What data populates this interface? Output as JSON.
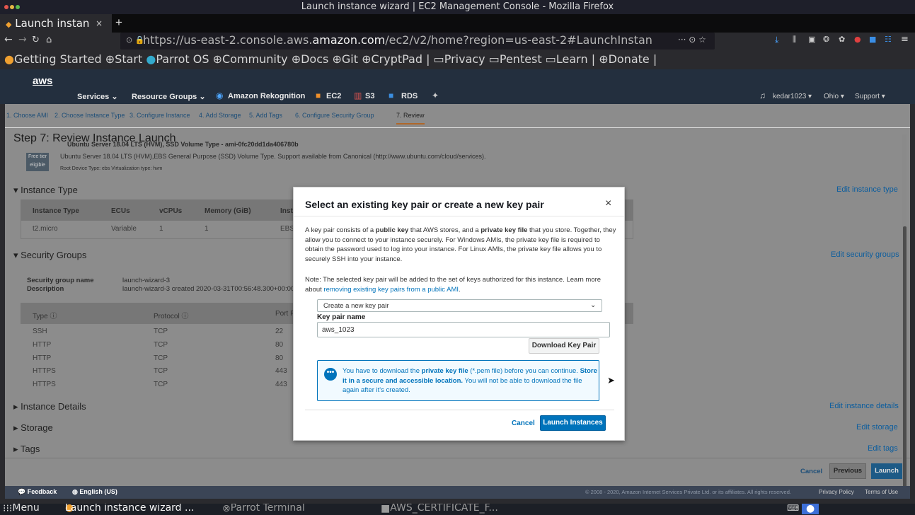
{
  "window": {
    "title": "Launch instance wizard | EC2 Management Console - Mozilla Firefox"
  },
  "browser": {
    "tab_label": "Launch instan",
    "tab_close": "×",
    "new_tab": "+",
    "url_prefix": "https://us-east-2.console.aws.",
    "url_domain": "amazon.com",
    "url_suffix": "/ec2/v2/home?region=us-east-2#LaunchInstan",
    "url_more": "··· ⊙ ☆",
    "bookmarks": [
      "Getting Started",
      "Start",
      "Parrot OS",
      "Community",
      "Docs",
      "Git",
      "CryptPad",
      "Privacy",
      "Pentest",
      "Learn",
      "Donate"
    ]
  },
  "aws_nav": {
    "logo": "aws",
    "services": "Services",
    "resource_groups": "Resource Groups",
    "rekognition": "Amazon Rekognition",
    "ec2": "EC2",
    "s3": "S3",
    "rds": "RDS",
    "user": "kedar1023",
    "region": "Ohio",
    "support": "Support"
  },
  "steps": [
    "1. Choose AMI",
    "2. Choose Instance Type",
    "3. Configure Instance",
    "4. Add Storage",
    "5. Add Tags",
    "6. Configure Security Group",
    "7. Review"
  ],
  "page": {
    "step_title": "Step 7: Review Instance Launch",
    "ami_title": "Ubuntu Server 18.04 LTS (HVM), SSD Volume Type - ami-0fc20dd1da406780b",
    "free_tier_1": "Free tier",
    "free_tier_2": "eligible",
    "ami_desc": "Ubuntu Server 18.04 LTS (HVM),EBS General Purpose (SSD) Volume Type. Support available from Canonical (http://www.ubuntu.com/cloud/services).",
    "ami_meta": "Root Device Type: ebs    Virtualization type: hvm",
    "instance_type_h": "Instance Type",
    "edit_instance_type": "Edit instance type",
    "it_headers": [
      "Instance Type",
      "ECUs",
      "vCPUs",
      "Memory (GiB)",
      "Inst"
    ],
    "it_row": [
      "t2.micro",
      "Variable",
      "1",
      "1",
      "EBS"
    ],
    "security_groups_h": "Security Groups",
    "edit_security_groups": "Edit security groups",
    "sg_name_label": "Security group name",
    "sg_name_value": "launch-wizard-3",
    "sg_desc_label": "Description",
    "sg_desc_value": "launch-wizard-3 created 2020-03-31T00:56:48.300+00:00",
    "sg_headers": [
      "Type ⓘ",
      "Protocol ⓘ",
      "Port F"
    ],
    "sg_rows": [
      [
        "SSH",
        "TCP",
        "22"
      ],
      [
        "HTTP",
        "TCP",
        "80"
      ],
      [
        "HTTP",
        "TCP",
        "80"
      ],
      [
        "HTTPS",
        "TCP",
        "443"
      ],
      [
        "HTTPS",
        "TCP",
        "443"
      ]
    ],
    "instance_details_h": "Instance Details",
    "edit_instance_details": "Edit instance details",
    "storage_h": "Storage",
    "edit_storage": "Edit storage",
    "tags_h": "Tags",
    "edit_tags": "Edit tags",
    "cancel": "Cancel",
    "previous": "Previous",
    "launch": "Launch"
  },
  "modal": {
    "title": "Select an existing key pair or create a new key pair",
    "close": "×",
    "p1_a": "A key pair consists of a ",
    "p1_b": "public key",
    "p1_c": " that AWS stores, and a ",
    "p1_d": "private key file",
    "p1_e": " that you store. Together, they allow you to connect to your instance securely. For Windows AMIs, the private key file is required to obtain the password used to log into your instance. For Linux AMIs, the private key file allows you to securely SSH into your instance.",
    "p2_a": "Note: The selected key pair will be added to the set of keys authorized for this instance. Learn more about ",
    "p2_link": "removing existing key pairs from a public AMI",
    "p2_b": ".",
    "select_value": "Create a new key pair",
    "key_pair_label": "Key pair name",
    "key_pair_value": "aws_1023",
    "download_btn": "Download Key Pair",
    "info_a": "You have to download the ",
    "info_b": "private key file",
    "info_c": " (*.pem file) before you can continue. ",
    "info_d": "Store it in a secure and accessible location.",
    "info_e": " You will not be able to download the file again after it's created.",
    "cancel": "Cancel",
    "launch": "Launch Instances"
  },
  "footer": {
    "feedback": "Feedback",
    "language": "English (US)",
    "copyright": "© 2008 - 2020, Amazon Internet Services Private Ltd. or its affiliates. All rights reserved.",
    "privacy": "Privacy Policy",
    "terms": "Terms of Use"
  },
  "taskbar": {
    "menu": "Menu",
    "task1": "Launch instance wizard ...",
    "task2": "Parrot Terminal",
    "task3": "AWS_CERTIFICATE_F..."
  },
  "colors": {
    "accent": "#0073bb",
    "aws_nav": "#232f3e",
    "overlay": "#8c8c8c"
  }
}
